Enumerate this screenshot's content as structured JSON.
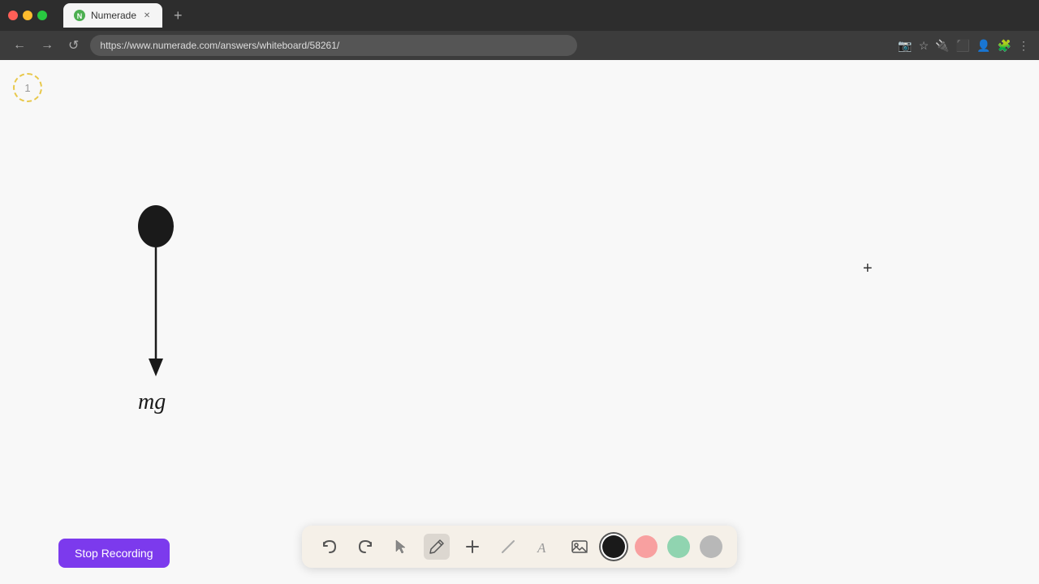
{
  "browser": {
    "tab_title": "Numerade",
    "tab_favicon": "N",
    "url": "https://www.numerade.com/answers/whiteboard/58261/",
    "new_tab_icon": "+"
  },
  "nav": {
    "back_icon": "←",
    "forward_icon": "→",
    "refresh_icon": "↺"
  },
  "page_indicator": {
    "number": "1"
  },
  "toolbar": {
    "undo_label": "↺",
    "redo_label": "↻",
    "select_label": "▲",
    "pen_label": "✏",
    "plus_label": "+",
    "eraser_label": "/",
    "text_label": "A",
    "image_label": "🖼",
    "colors": [
      "#1a1a1a",
      "#f8a0a0",
      "#90d4b0",
      "#b8b8b8"
    ],
    "color_names": [
      "black",
      "pink",
      "green",
      "gray"
    ]
  },
  "stop_recording": {
    "label": "Stop Recording"
  },
  "whiteboard": {
    "drawing_description": "pendulum with mg label and downward arrow"
  },
  "cursor": {
    "symbol": "+"
  }
}
